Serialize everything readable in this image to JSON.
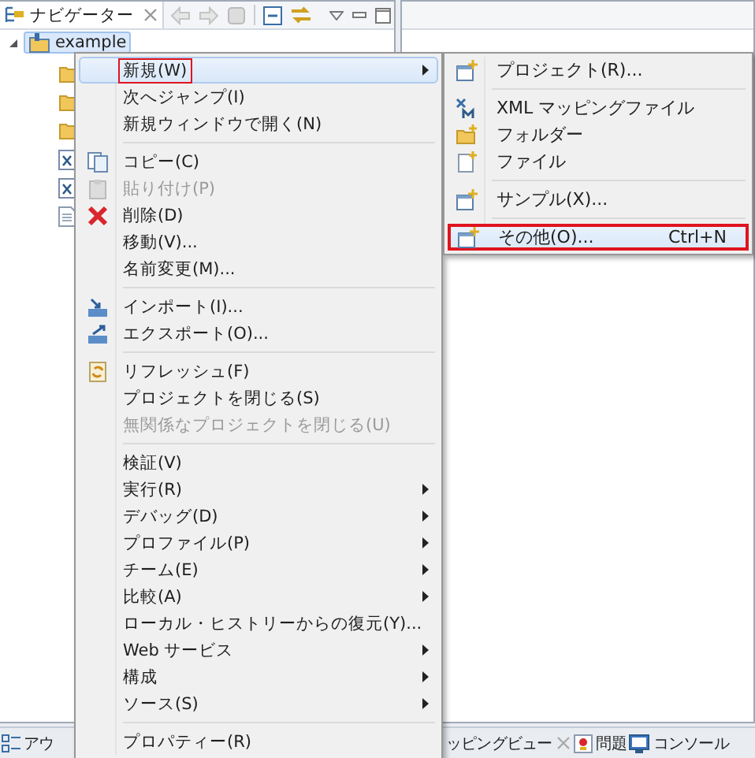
{
  "navigator": {
    "title": "ナビゲーター"
  },
  "tree": {
    "label": "example",
    "expanded": true,
    "children": [
      {
        "kind": "folder"
      },
      {
        "kind": "folder"
      },
      {
        "kind": "folder"
      },
      {
        "kind": "xml"
      },
      {
        "kind": "xml"
      },
      {
        "kind": "doc"
      }
    ]
  },
  "context_menu": [
    {
      "kind": "item",
      "label": "新規(W)",
      "submenu": true,
      "disabled": false,
      "selected": true,
      "outlined": true
    },
    {
      "kind": "item",
      "label": "次へジャンプ(I)",
      "submenu": false,
      "disabled": false,
      "selected": false,
      "outlined": false
    },
    {
      "kind": "item",
      "label": "新規ウィンドウで開く(N)",
      "submenu": false,
      "disabled": false,
      "selected": false,
      "outlined": false
    },
    {
      "kind": "separator"
    },
    {
      "kind": "item",
      "label": "コピー(C)",
      "submenu": false,
      "disabled": false,
      "selected": false,
      "outlined": false
    },
    {
      "kind": "item",
      "label": "貼り付け(P)",
      "submenu": false,
      "disabled": true,
      "selected": false,
      "outlined": false
    },
    {
      "kind": "item",
      "label": "削除(D)",
      "submenu": false,
      "disabled": false,
      "selected": false,
      "outlined": false
    },
    {
      "kind": "item",
      "label": "移動(V)...",
      "submenu": false,
      "disabled": false,
      "selected": false,
      "outlined": false
    },
    {
      "kind": "item",
      "label": "名前変更(M)...",
      "submenu": false,
      "disabled": false,
      "selected": false,
      "outlined": false
    },
    {
      "kind": "separator"
    },
    {
      "kind": "item",
      "label": "インポート(I)...",
      "submenu": false,
      "disabled": false,
      "selected": false,
      "outlined": false
    },
    {
      "kind": "item",
      "label": "エクスポート(O)...",
      "submenu": false,
      "disabled": false,
      "selected": false,
      "outlined": false
    },
    {
      "kind": "separator"
    },
    {
      "kind": "item",
      "label": "リフレッシュ(F)",
      "submenu": false,
      "disabled": false,
      "selected": false,
      "outlined": false
    },
    {
      "kind": "item",
      "label": "プロジェクトを閉じる(S)",
      "submenu": false,
      "disabled": false,
      "selected": false,
      "outlined": false
    },
    {
      "kind": "item",
      "label": "無関係なプロジェクトを閉じる(U)",
      "submenu": false,
      "disabled": true,
      "selected": false,
      "outlined": false
    },
    {
      "kind": "separator"
    },
    {
      "kind": "item",
      "label": "検証(V)",
      "submenu": false,
      "disabled": false,
      "selected": false,
      "outlined": false
    },
    {
      "kind": "item",
      "label": "実行(R)",
      "submenu": true,
      "disabled": false,
      "selected": false,
      "outlined": false
    },
    {
      "kind": "item",
      "label": "デバッグ(D)",
      "submenu": true,
      "disabled": false,
      "selected": false,
      "outlined": false
    },
    {
      "kind": "item",
      "label": "プロファイル(P)",
      "submenu": true,
      "disabled": false,
      "selected": false,
      "outlined": false
    },
    {
      "kind": "item",
      "label": "チーム(E)",
      "submenu": true,
      "disabled": false,
      "selected": false,
      "outlined": false
    },
    {
      "kind": "item",
      "label": "比較(A)",
      "submenu": true,
      "disabled": false,
      "selected": false,
      "outlined": false
    },
    {
      "kind": "item",
      "label": "ローカル・ヒストリーからの復元(Y)...",
      "submenu": false,
      "disabled": false,
      "selected": false,
      "outlined": false
    },
    {
      "kind": "item",
      "label": "Web サービス",
      "submenu": true,
      "disabled": false,
      "selected": false,
      "outlined": false
    },
    {
      "kind": "item",
      "label": "構成",
      "submenu": true,
      "disabled": false,
      "selected": false,
      "outlined": false
    },
    {
      "kind": "item",
      "label": "ソース(S)",
      "submenu": true,
      "disabled": false,
      "selected": false,
      "outlined": false
    },
    {
      "kind": "separator"
    },
    {
      "kind": "item",
      "label": "プロパティー(R)",
      "submenu": false,
      "disabled": false,
      "selected": false,
      "outlined": false
    }
  ],
  "new_submenu": [
    {
      "kind": "item",
      "label": "プロジェクト(R)...",
      "selected": false,
      "outlined": false
    },
    {
      "kind": "separator"
    },
    {
      "kind": "item",
      "label": "XML マッピングファイル",
      "selected": false,
      "outlined": false
    },
    {
      "kind": "item",
      "label": "フォルダー",
      "selected": false,
      "outlined": false
    },
    {
      "kind": "item",
      "label": "ファイル",
      "selected": false,
      "outlined": false
    },
    {
      "kind": "separator"
    },
    {
      "kind": "item",
      "label": "サンプル(X)...",
      "selected": false,
      "outlined": false
    },
    {
      "kind": "separator"
    },
    {
      "kind": "item",
      "label": "その他(O)...",
      "shortcut": "Ctrl+N",
      "selected": true,
      "outlined": true
    }
  ],
  "bottom_left_tabs": [
    {
      "label": "アウ"
    }
  ],
  "bottom_right_tabs": [
    {
      "label": "ッピングビュー",
      "closable": true
    },
    {
      "label": "問題",
      "closable": false
    },
    {
      "label": "コンソール",
      "closable": false
    }
  ]
}
